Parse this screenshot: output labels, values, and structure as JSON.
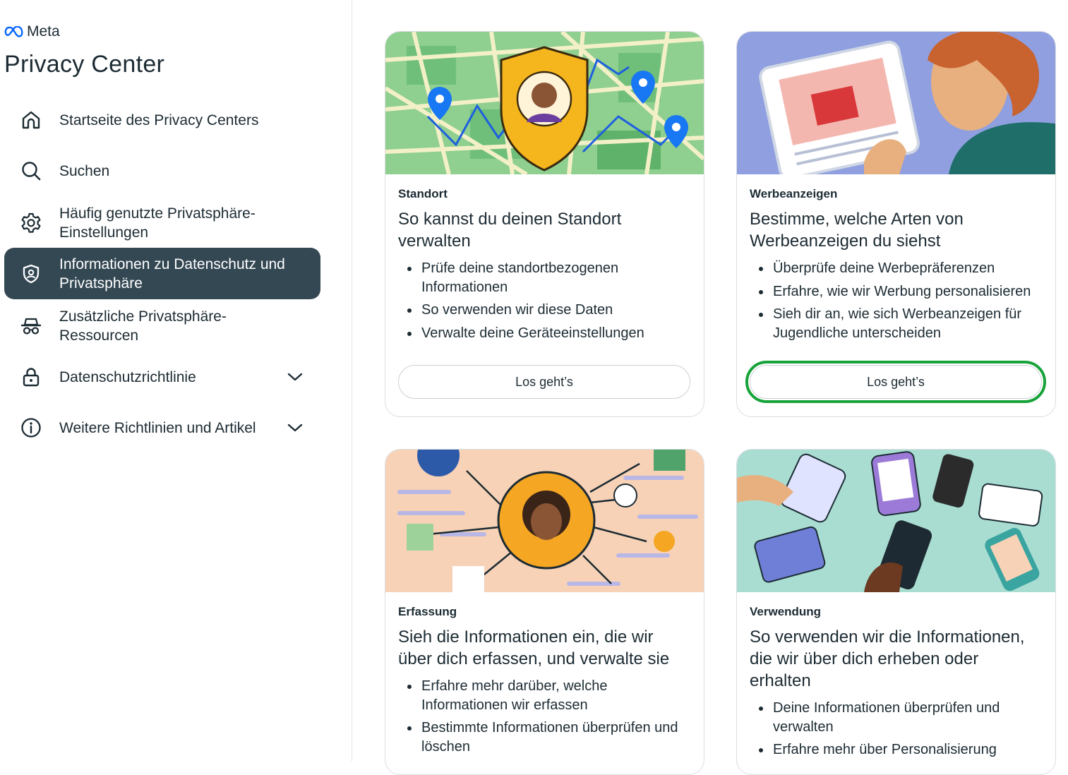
{
  "brand": {
    "logo_text": "Meta",
    "title": "Privacy Center"
  },
  "sidebar": {
    "items": [
      {
        "label": "Startseite des Privacy Centers"
      },
      {
        "label": "Suchen"
      },
      {
        "label": "Häufig genutzte Privatsphäre-Einstellungen"
      },
      {
        "label": "Informationen zu Datenschutz und Privatsphäre",
        "active": true
      },
      {
        "label": "Zusätzliche Privatsphäre-Ressourcen"
      },
      {
        "label": "Datenschutzrichtlinie",
        "expandable": true
      },
      {
        "label": "Weitere Richtlinien und Artikel",
        "expandable": true
      }
    ]
  },
  "cards": [
    {
      "category": "Standort",
      "title": "So kannst du deinen Standort verwalten",
      "bullets": [
        "Prüfe deine standortbezogenen Informationen",
        "So verwenden wir diese Daten",
        "Verwalte deine Geräteeinstellungen"
      ],
      "button": "Los geht’s"
    },
    {
      "category": "Werbeanzeigen",
      "title": "Bestimme, welche Arten von Werbeanzeigen du siehst",
      "bullets": [
        "Überprüfe deine Werbepräferenzen",
        "Erfahre, wie wir Werbung personalisieren",
        "Sieh dir an, wie sich Werbeanzeigen für Jugendliche unterscheiden"
      ],
      "button": "Los geht’s"
    },
    {
      "category": "Erfassung",
      "title": "Sieh die Informationen ein, die wir über dich erfassen, und verwalte sie",
      "bullets": [
        "Erfahre mehr darüber, welche Informationen wir erfassen",
        "Bestimmte Informationen überprüfen und löschen"
      ]
    },
    {
      "category": "Verwendung",
      "title": "So verwenden wir die Informationen, die wir über dich erheben oder erhalten",
      "bullets": [
        "Deine Informationen überprüfen und verwalten",
        "Erfahre mehr über Personalisierung"
      ]
    }
  ],
  "colors": {
    "active_nav_bg": "#344854",
    "highlight": "#17a33a",
    "meta_blue": "#0866ff"
  }
}
